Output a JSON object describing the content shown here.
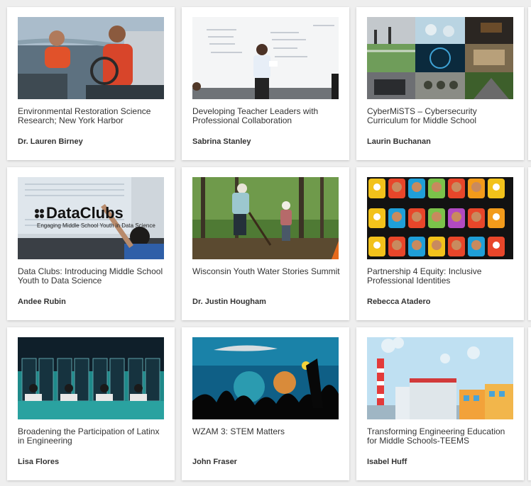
{
  "cards": [
    {
      "title": "Environmental Restoration Science Research; New York Harbor",
      "author": "Dr. Lauren Birney",
      "image": "harbor-boat-photo"
    },
    {
      "title": "Developing Teacher Leaders with Professional Collaboration",
      "author": "Sabrina Stanley",
      "image": "classroom-whiteboard-photo"
    },
    {
      "title": "CyberMiSTS – Cybersecurity Curriculum for Middle School",
      "author": "Laurin Buchanan",
      "image": "cyber-collage-photo"
    },
    {
      "title": "Data Clubs: Introducing Middle School Youth to Data Science",
      "author": "Andee Rubin",
      "image": "dataclubs-photo",
      "logo_text": "DataClubs",
      "logo_subtitle": "Engaging Middle School Youth in Data Science"
    },
    {
      "title": "Wisconsin Youth Water Stories Summit",
      "author": "Dr. Justin Hougham",
      "image": "forest-digging-photo"
    },
    {
      "title": "Partnership 4 Equity: Inclusive Professional Identities",
      "author": "Rebecca Atadero",
      "image": "avatar-grid-illustration"
    },
    {
      "title": "Broadening the Participation of Latinx in Engineering",
      "author": "Lisa Flores",
      "image": "server-room-illustration"
    },
    {
      "title": "WZAM 3: STEM Matters",
      "author": "John Fraser",
      "image": "aquarium-crowd-photo"
    },
    {
      "title": "Transforming Engineering Education for Middle Schools-TEEMS",
      "author": "Isabel Huff",
      "image": "factory-illustration"
    }
  ],
  "colors": {
    "page_bg": "#eeeeee",
    "card_bg": "#ffffff",
    "text": "#333333"
  }
}
